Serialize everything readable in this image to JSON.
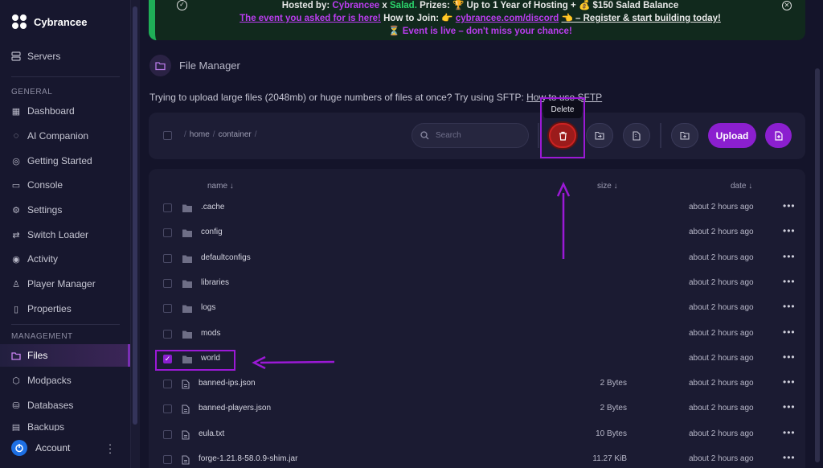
{
  "brand": {
    "name": "Cybrancee"
  },
  "sidebar": {
    "servers": "Servers",
    "general_label": "GENERAL",
    "general": [
      {
        "label": "Dashboard",
        "icon": "dashboard-icon"
      },
      {
        "label": "AI Companion",
        "icon": "chat-icon"
      },
      {
        "label": "Getting Started",
        "icon": "lifebuoy-icon"
      },
      {
        "label": "Console",
        "icon": "terminal-icon"
      },
      {
        "label": "Settings",
        "icon": "gear-icon"
      },
      {
        "label": "Switch Loader",
        "icon": "swap-icon"
      },
      {
        "label": "Activity",
        "icon": "eye-icon"
      },
      {
        "label": "Player Manager",
        "icon": "user-icon"
      },
      {
        "label": "Properties",
        "icon": "document-icon"
      }
    ],
    "management_label": "MANAGEMENT",
    "management": [
      {
        "label": "Files",
        "icon": "folder-icon",
        "active": true
      },
      {
        "label": "Modpacks",
        "icon": "cube-icon"
      },
      {
        "label": "Databases",
        "icon": "database-icon"
      },
      {
        "label": "Backups",
        "icon": "archive-icon"
      }
    ],
    "account": "Account"
  },
  "banner": {
    "line1_a": "Hosted by:",
    "line1_b": "Cybrancee",
    "line1_c": "x",
    "line1_d": "Salad.",
    "line1_e": "Prizes: 🏆 Up to 1 Year of Hosting + 💰 $150 Salad Balance",
    "line2_a": "The event you asked for is here!",
    "line2_b": "How to Join: 👉",
    "line2_c": "cybrancee.com/discord",
    "line2_d": "👈 – Register & start building today!",
    "line3": "⏳ Event is live – don't miss your chance!"
  },
  "file_manager": {
    "title": "File Manager",
    "hint_text": "Trying to upload large files (2048mb) or huge numbers of files at once? Try using SFTP:",
    "hint_link": "How to use SFTP",
    "breadcrumb": [
      "home",
      "container"
    ],
    "search_placeholder": "Search",
    "tooltip": "Delete",
    "upload_label": "Upload"
  },
  "table": {
    "col_name": "name ↓",
    "col_size": "size ↓",
    "col_date": "date ↓",
    "rows": [
      {
        "name": ".cache",
        "type": "folder",
        "size": "",
        "date": "about 2 hours ago",
        "checked": false
      },
      {
        "name": "config",
        "type": "folder",
        "size": "",
        "date": "about 2 hours ago",
        "checked": false
      },
      {
        "name": "defaultconfigs",
        "type": "folder",
        "size": "",
        "date": "about 2 hours ago",
        "checked": false
      },
      {
        "name": "libraries",
        "type": "folder",
        "size": "",
        "date": "about 2 hours ago",
        "checked": false
      },
      {
        "name": "logs",
        "type": "folder",
        "size": "",
        "date": "about 2 hours ago",
        "checked": false
      },
      {
        "name": "mods",
        "type": "folder",
        "size": "",
        "date": "about 2 hours ago",
        "checked": false
      },
      {
        "name": "world",
        "type": "folder",
        "size": "",
        "date": "about 2 hours ago",
        "checked": true
      },
      {
        "name": "banned-ips.json",
        "type": "file",
        "size": "2 Bytes",
        "date": "about 2 hours ago",
        "checked": false
      },
      {
        "name": "banned-players.json",
        "type": "file",
        "size": "2 Bytes",
        "date": "about 2 hours ago",
        "checked": false
      },
      {
        "name": "eula.txt",
        "type": "file",
        "size": "10 Bytes",
        "date": "about 2 hours ago",
        "checked": false
      },
      {
        "name": "forge-1.21.8-58.0.9-shim.jar",
        "type": "file",
        "size": "11.27 KiB",
        "date": "about 2 hours ago",
        "checked": false
      }
    ]
  },
  "colors": {
    "accent": "#8b1fcf",
    "delete": "#9b1b1b",
    "banner_green": "#1fae57"
  }
}
